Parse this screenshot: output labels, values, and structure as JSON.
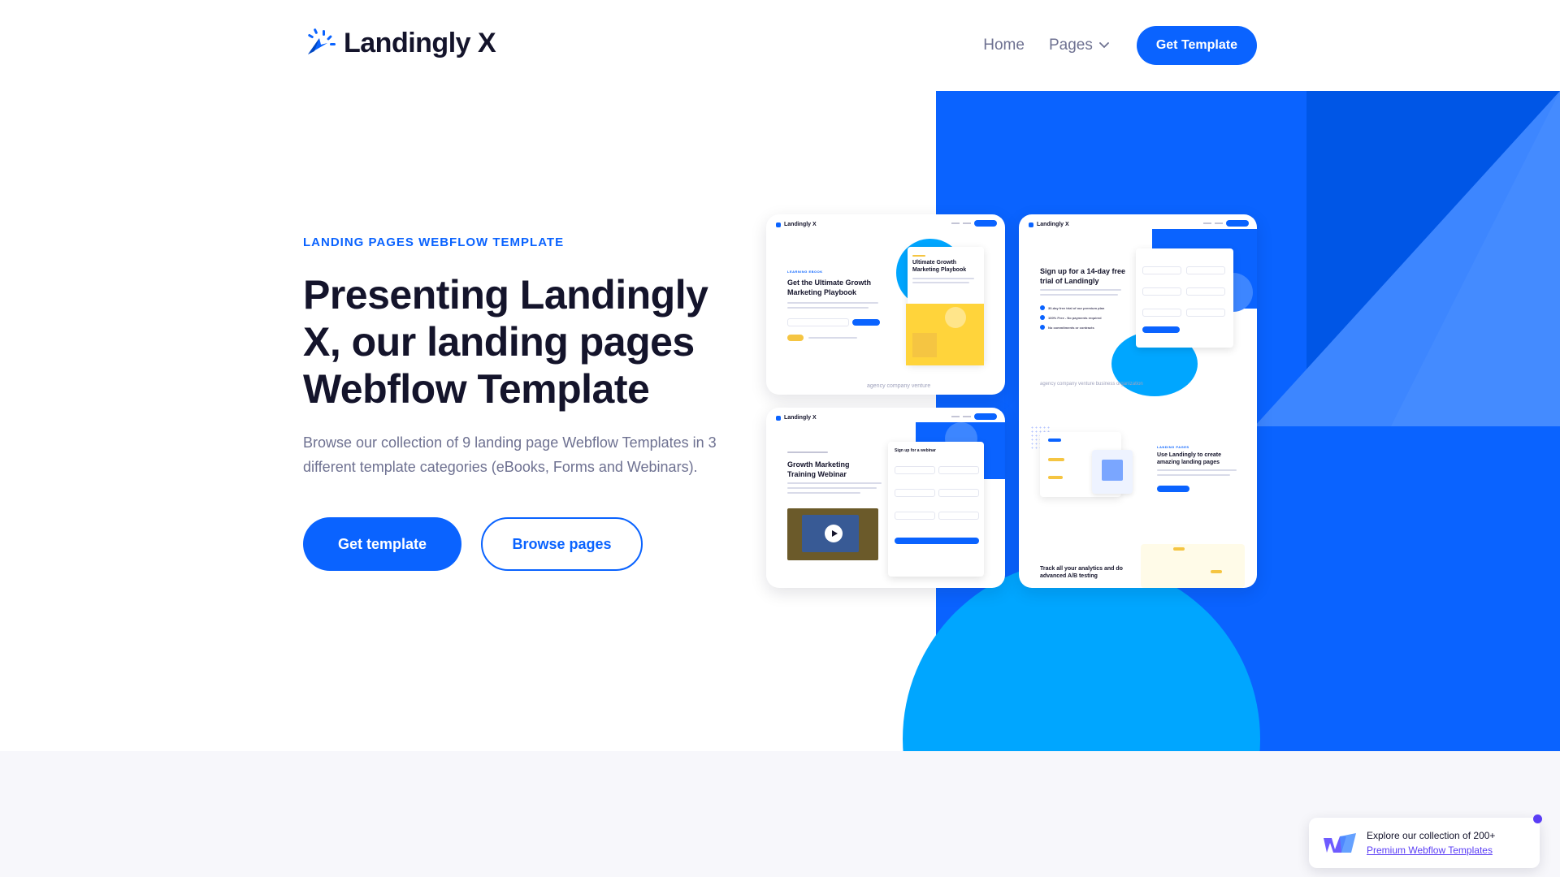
{
  "header": {
    "logo_text": "Landingly X",
    "nav": {
      "home": "Home",
      "pages": "Pages",
      "cta": "Get Template"
    }
  },
  "hero": {
    "eyebrow": "LANDING PAGES WEBFLOW TEMPLATE",
    "headline": "Presenting Landingly X, our landing pages Webflow Template",
    "subtext": "Browse our collection of 9 landing page Webflow Templates in 3 different template categories (eBooks, Forms and Webinars).",
    "primary_button": "Get template",
    "secondary_button": "Browse pages"
  },
  "previews": {
    "card1": {
      "logo": "Landingly X",
      "title": "Get the Ultimate Growth Marketing Playbook",
      "book_title": "Ultimate Growth Marketing Playbook",
      "logos": "agency  company  venture"
    },
    "card2": {
      "logo": "Landingly X",
      "title": "Growth Marketing Training Webinar",
      "form_title": "Sign up for a webinar"
    },
    "card3": {
      "logo": "Landingly X",
      "title": "Sign up for a 14-day free trial of Landingly",
      "checks": [
        "30-day free trial of our premium plan",
        "100% Free - No payments required",
        "No commitments or contracts"
      ],
      "logos": "agency   company   venture   business   organization",
      "feature_title": "Use Landingly to create amazing landing pages",
      "bottom_title": "Track all your analytics and do advanced A/B testing"
    }
  },
  "badge": {
    "line1": "Explore our collection of 200+",
    "link": "Premium Webflow Templates"
  },
  "colors": {
    "primary": "#0a63ff",
    "dark": "#14142b",
    "muted": "#6e7191",
    "accent_circle": "#00a6ff",
    "badge_link": "#5a3df5"
  }
}
